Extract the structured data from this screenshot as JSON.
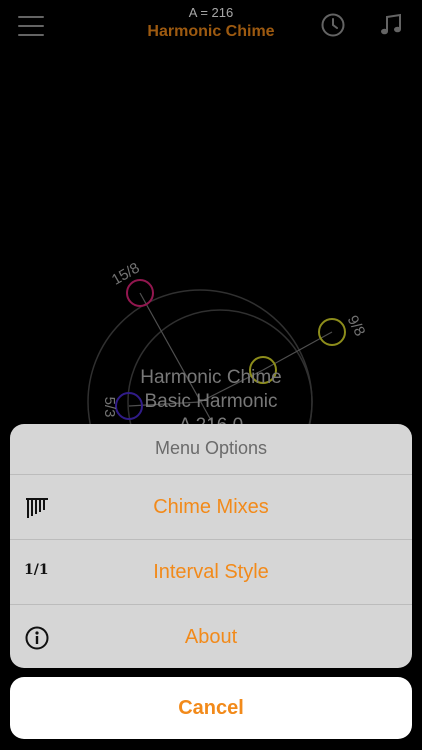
{
  "header": {
    "subtitle": "A = 216",
    "title": "Harmonic Chime"
  },
  "diagram": {
    "nodes": [
      {
        "label": "15/8",
        "color": "#e0247a"
      },
      {
        "label": "9/8",
        "color": "#d9d92a"
      },
      {
        "label": "5/3",
        "color": "#4b2bd1"
      },
      {
        "label": "",
        "color": "#d9d92a"
      }
    ],
    "center_lines": [
      "Harmonic Chime",
      "Basic Harmonic",
      "A 216.0"
    ]
  },
  "menu": {
    "title": "Menu Options",
    "items": [
      {
        "label": "Chime Mixes",
        "icon": "chimes-icon"
      },
      {
        "label": "Interval Style",
        "icon": "ratio-icon",
        "icon_text": "1/1"
      },
      {
        "label": "About",
        "icon": "info-icon"
      }
    ],
    "cancel_label": "Cancel"
  },
  "colors": {
    "accent": "#f28a1a",
    "background": "#000000",
    "sheet": "#d6d6d6"
  }
}
